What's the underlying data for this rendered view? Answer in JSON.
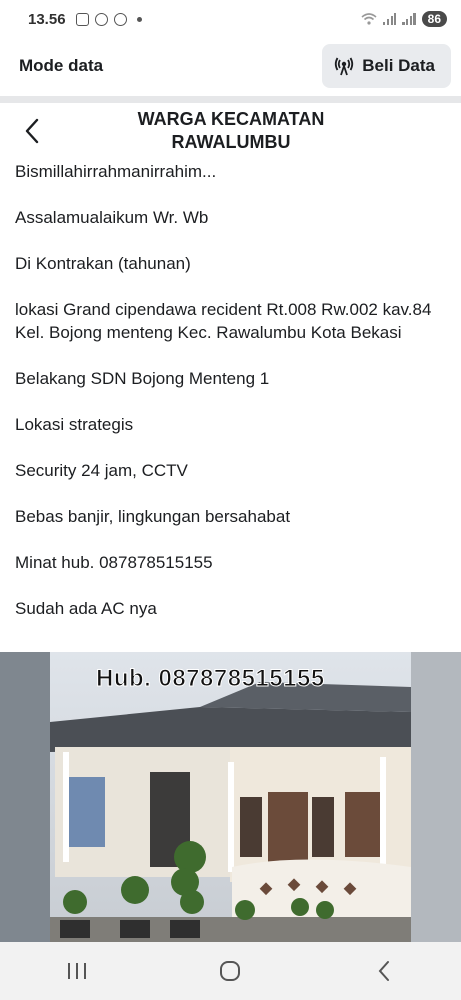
{
  "status_bar": {
    "time": "13.56",
    "battery": "86"
  },
  "data_bar": {
    "mode_label": "Mode data",
    "buy_label": "Beli Data"
  },
  "header": {
    "title": "WARGA KECAMATAN RAWALUMBU"
  },
  "post": {
    "paragraphs": [
      "Bismillahirrahmanirrahim...",
      "Assalamualaikum Wr. Wb",
      "Di Kontrakan (tahunan)",
      "lokasi Grand cipendawa recident Rt.008 Rw.002 kav.84 Kel. Bojong menteng Kec. Rawalumbu Kota Bekasi",
      "Belakang SDN Bojong Menteng 1",
      "Lokasi strategis",
      "Security 24 jam, CCTV",
      "Bebas banjir, lingkungan bersahabat",
      "Minat hub. 087878515155",
      "Sudah ada AC nya"
    ]
  },
  "photo": {
    "caption": "Hub. 087878515155"
  },
  "icons": {
    "back": "chevron-left-icon",
    "broadcast": "broadcast-icon",
    "nav_recents": "recents-icon",
    "nav_home": "home-icon",
    "nav_back": "back-icon"
  }
}
